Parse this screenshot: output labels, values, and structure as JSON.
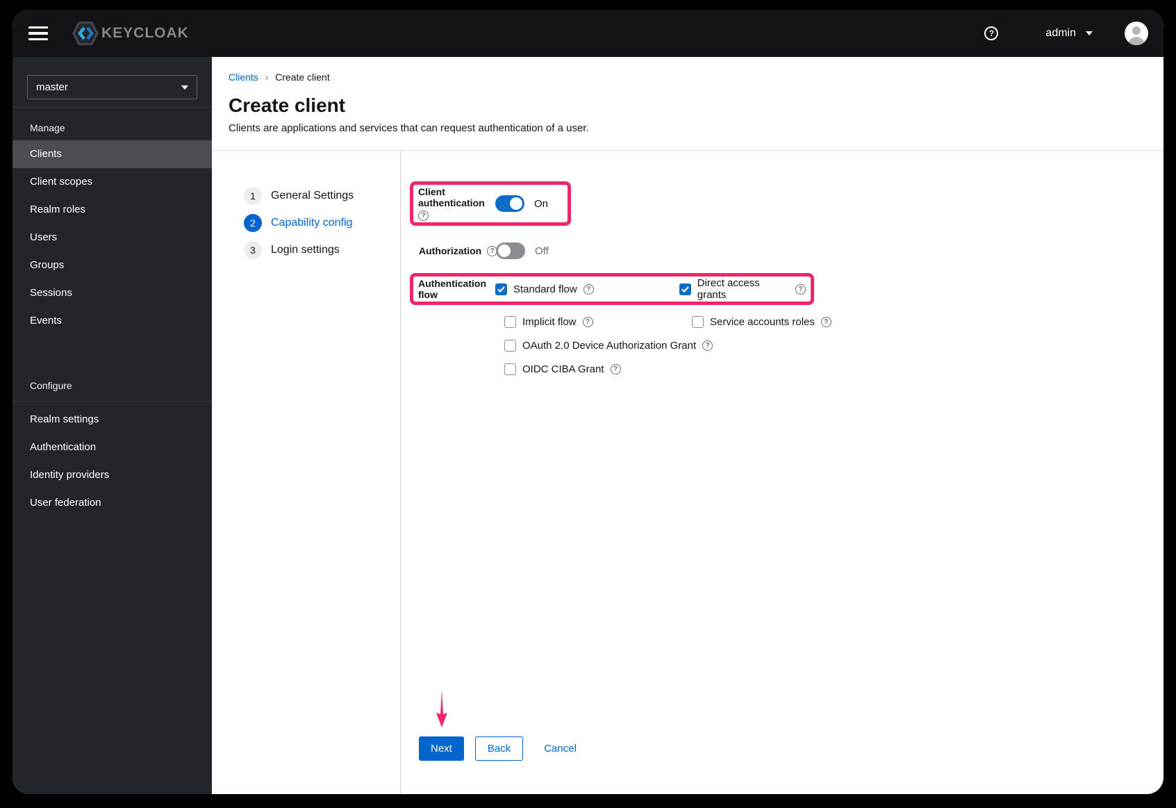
{
  "topbar": {
    "brand": "KEYCLOAK",
    "user": "admin"
  },
  "icons": {
    "help": "?"
  },
  "sidebar": {
    "realm": "master",
    "selected": "Clients",
    "sections": [
      {
        "heading": "Manage",
        "items": [
          "Clients",
          "Client scopes",
          "Realm roles",
          "Users",
          "Groups",
          "Sessions",
          "Events"
        ]
      },
      {
        "heading": "Configure",
        "items": [
          "Realm settings",
          "Authentication",
          "Identity providers",
          "User federation"
        ]
      }
    ]
  },
  "breadcrumb": {
    "parent": "Clients",
    "current": "Create client"
  },
  "page": {
    "title": "Create client",
    "subtitle": "Clients are applications and services that can request authentication of a user."
  },
  "wizard": {
    "steps": [
      {
        "num": "1",
        "label": "General Settings",
        "active": false
      },
      {
        "num": "2",
        "label": "Capability config",
        "active": true
      },
      {
        "num": "3",
        "label": "Login settings",
        "active": false
      }
    ]
  },
  "form": {
    "client_auth": {
      "label": "Client authentication",
      "state": "On",
      "enabled": true
    },
    "authorization": {
      "label": "Authorization",
      "state": "Off",
      "enabled": false
    },
    "auth_flow": {
      "label": "Authentication flow",
      "options": [
        {
          "label": "Standard flow",
          "checked": true
        },
        {
          "label": "Direct access grants",
          "checked": true
        },
        {
          "label": "Implicit flow",
          "checked": false
        },
        {
          "label": "Service accounts roles",
          "checked": false
        },
        {
          "label": "OAuth 2.0 Device Authorization Grant",
          "checked": false
        },
        {
          "label": "OIDC CIBA Grant",
          "checked": false
        }
      ]
    }
  },
  "footer": {
    "next": "Next",
    "back": "Back",
    "cancel": "Cancel"
  },
  "colors": {
    "accent": "#0066cc",
    "toggle_on": "#0e6cc4",
    "highlight": "#f0256b",
    "sidebar_bg": "#222529",
    "topbar_bg": "#141416"
  }
}
